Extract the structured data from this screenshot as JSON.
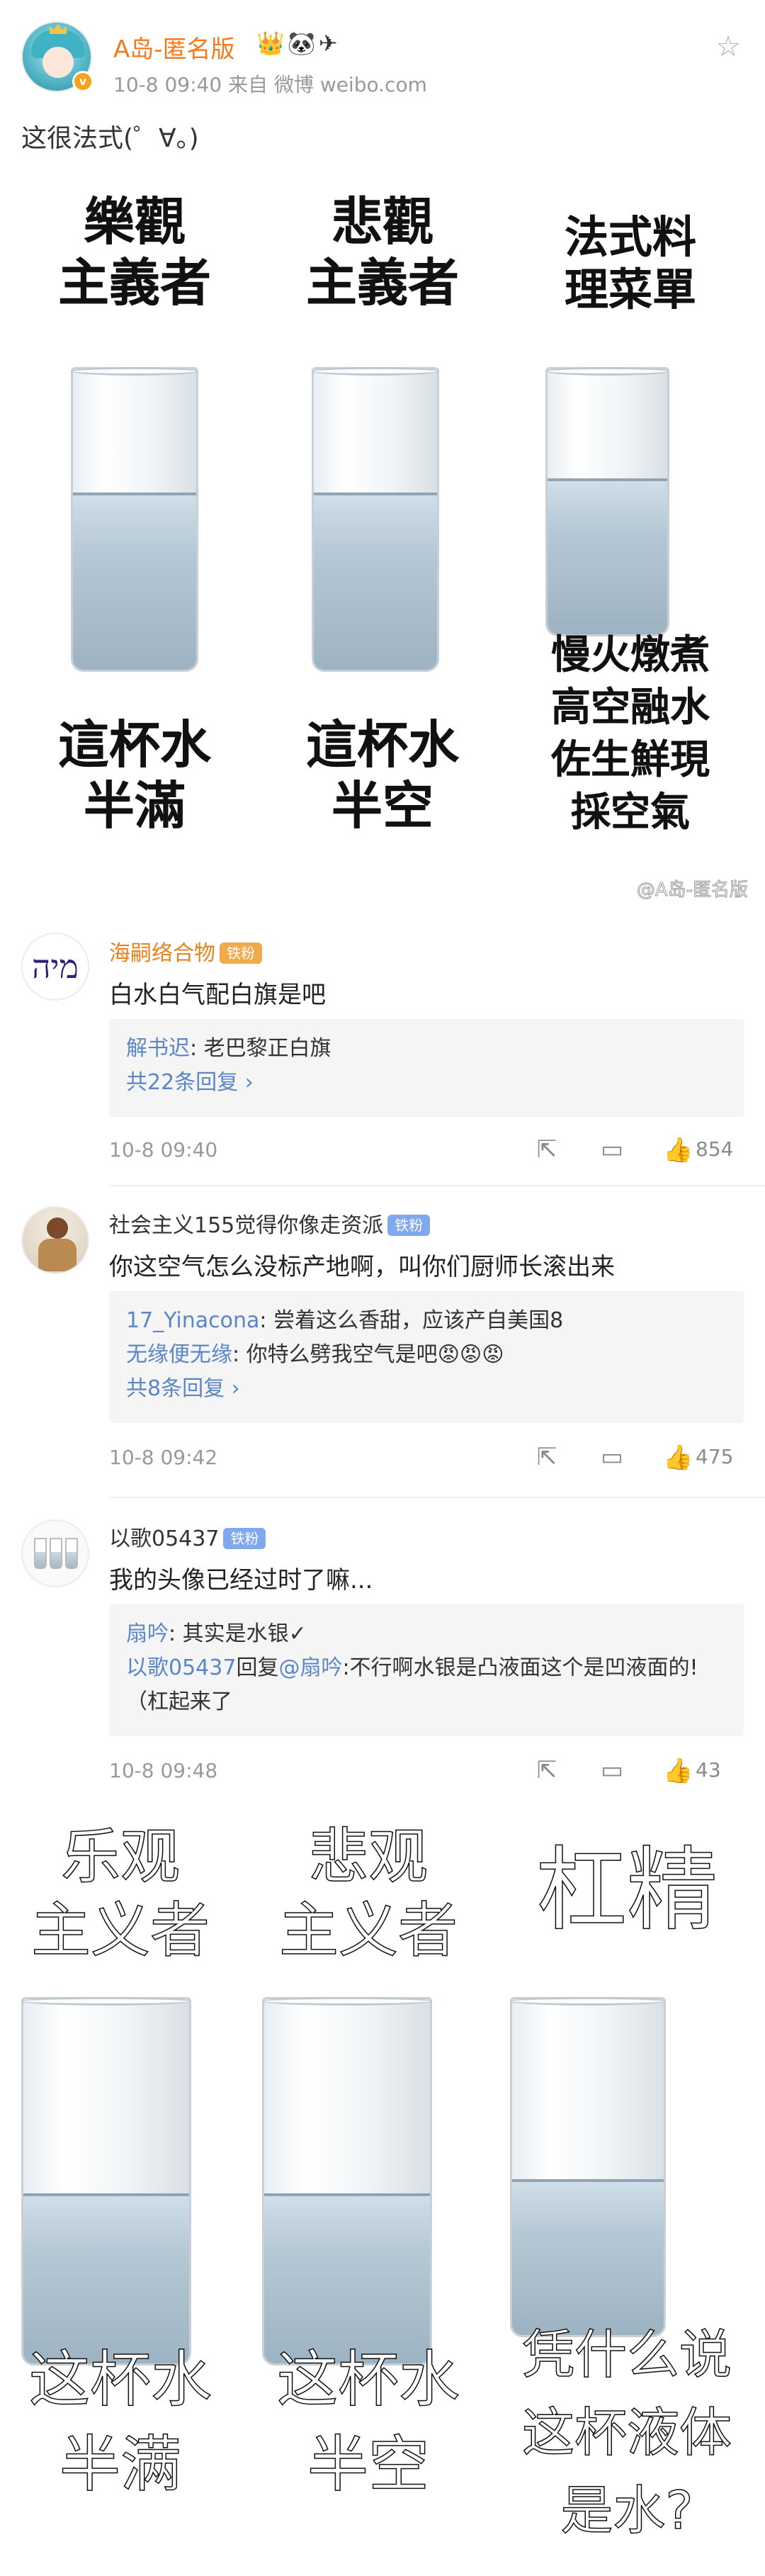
{
  "post": {
    "author": "A岛-匿名版",
    "author_badges": "👑🐼✈",
    "verified_badge": "v",
    "meta": "10-8 09:40  来自 微博 weibo.com",
    "text": "这很法式(゜∀。)",
    "star_icon": "☆"
  },
  "meme1": {
    "top_labels": [
      "樂觀\n主義者",
      "悲觀\n主義者",
      "法式料\n理菜單"
    ],
    "bottom_labels": [
      "這杯水\n半滿",
      "這杯水\n半空",
      "慢火燉煮\n高空融水\n佐生鮮現\n採空氣"
    ],
    "watermark": "@A岛-匿名版"
  },
  "comments": [
    {
      "avatar_text": "מיה",
      "name": "海嗣络合物",
      "badge": "铁粉",
      "text": "白水白气配白旗是吧",
      "replies": [
        {
          "name": "解书迟",
          "text": ": 老巴黎正白旗"
        }
      ],
      "more": "共22条回复 ›",
      "time": "10-8 09:40",
      "likes": "854"
    },
    {
      "name": "社会主义155觉得你像走资派",
      "badge": "铁粉",
      "text": "你这空气怎么没标产地啊，叫你们厨师长滚出来",
      "replies": [
        {
          "name": "17_Yinacona",
          "text": ": 尝着这么香甜，应该产自美国8"
        },
        {
          "name": "无缘便无缘",
          "text": ": 你特么劈我空气是吧😡😡😡"
        }
      ],
      "more": "共8条回复 ›",
      "time": "10-8 09:42",
      "likes": "475"
    },
    {
      "name": "以歌05437",
      "badge": "铁粉",
      "text": "我的头像已经过时了嘛...",
      "replies": [
        {
          "name": "扇吟",
          "text": ": 其实是水银✓"
        },
        {
          "name": "以歌05437",
          "text_prefix": "回复",
          "mention": "@扇吟",
          "text": ":不行啊水银是凸液面这个是凹液面的!（杠起来了"
        }
      ],
      "time": "10-8 09:48",
      "likes": "43"
    }
  ],
  "meme2": {
    "top_labels": [
      "乐观\n主义者",
      "悲观\n主义者",
      "杠精"
    ],
    "bottom_labels": [
      "这杯水\n半满",
      "这杯水\n半空",
      "凭什么说\n这杯液体\n是水?"
    ]
  },
  "icons": {
    "share": "⇱",
    "comment": "▭",
    "like": "👍"
  }
}
